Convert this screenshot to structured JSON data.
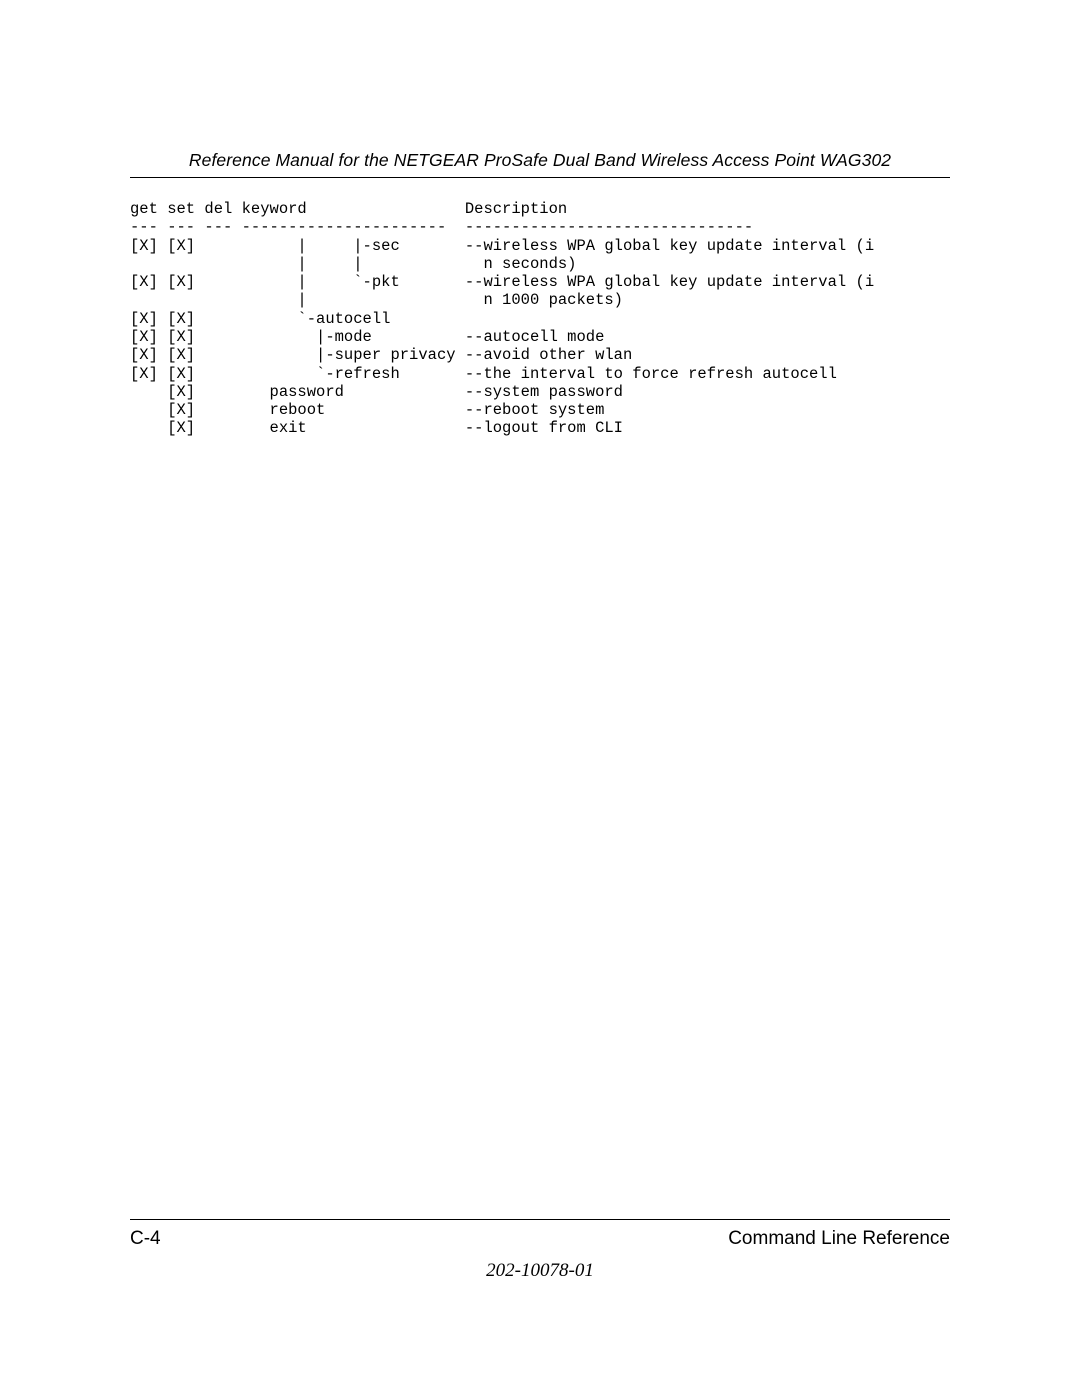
{
  "header": {
    "title": "Reference Manual for the NETGEAR ProSafe Dual Band Wireless Access Point WAG302"
  },
  "cli": {
    "col_get": "get",
    "col_set": "set",
    "col_del": "del",
    "col_keyword": "keyword",
    "col_desc": "Description",
    "dash_a": "---",
    "dash_b": "---",
    "dash_c": "---",
    "dash_d": "----------------------",
    "dash_e": "-------------------------------",
    "rows": [
      {
        "get": "[X]",
        "set": "[X]",
        "del": "",
        "keyword": "      |     |-sec",
        "desc": "--wireless WPA global key update interval (i"
      },
      {
        "get": "",
        "set": "",
        "del": "",
        "keyword": "      |     |",
        "desc": "  n seconds)"
      },
      {
        "get": "[X]",
        "set": "[X]",
        "del": "",
        "keyword": "      |     `-pkt",
        "desc": "--wireless WPA global key update interval (i"
      },
      {
        "get": "",
        "set": "",
        "del": "",
        "keyword": "      |",
        "desc": "  n 1000 packets)"
      },
      {
        "get": "[X]",
        "set": "[X]",
        "del": "",
        "keyword": "      `-autocell",
        "desc": ""
      },
      {
        "get": "[X]",
        "set": "[X]",
        "del": "",
        "keyword": "        |-mode",
        "desc": "--autocell mode"
      },
      {
        "get": "[X]",
        "set": "[X]",
        "del": "",
        "keyword": "        |-super privacy",
        "desc": "--avoid other wlan"
      },
      {
        "get": "[X]",
        "set": "[X]",
        "del": "",
        "keyword": "        `-refresh",
        "desc": "--the interval to force refresh autocell"
      },
      {
        "get": "",
        "set": "[X]",
        "del": "",
        "keyword": "   password",
        "desc": "--system password"
      },
      {
        "get": "",
        "set": "[X]",
        "del": "",
        "keyword": "   reboot",
        "desc": "--reboot system"
      },
      {
        "get": "",
        "set": "[X]",
        "del": "",
        "keyword": "   exit",
        "desc": "--logout from CLI"
      }
    ]
  },
  "footer": {
    "page_num": "C-4",
    "section": "Command Line Reference",
    "doc_num": "202-10078-01"
  }
}
